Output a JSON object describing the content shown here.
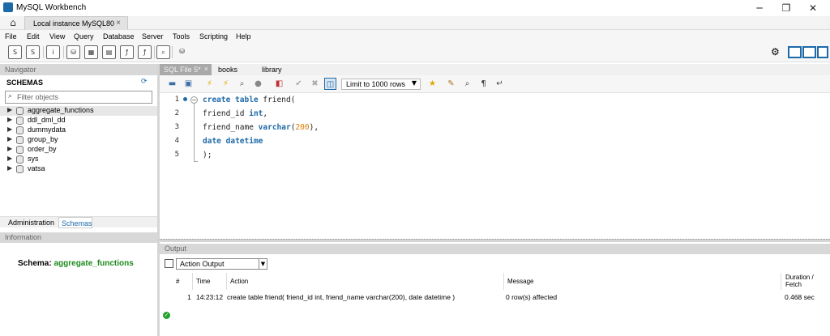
{
  "window": {
    "title": "MySQL Workbench",
    "minimize_glyph": "─",
    "maximize_glyph": "❐",
    "close_glyph": "✕"
  },
  "connection_tab": {
    "label": "Local instance MySQL80",
    "close_glyph": "×"
  },
  "menu": [
    "File",
    "Edit",
    "View",
    "Query",
    "Database",
    "Server",
    "Tools",
    "Scripting",
    "Help"
  ],
  "navigator": {
    "header": "Navigator",
    "schemas_title": "SCHEMAS",
    "filter_placeholder": "Filter objects",
    "schemas": [
      {
        "name": "aggregate_functions",
        "selected": true
      },
      {
        "name": "ddl_dml_dd"
      },
      {
        "name": "dummydata"
      },
      {
        "name": "group_by"
      },
      {
        "name": "order_by"
      },
      {
        "name": "sys"
      },
      {
        "name": "vatsa"
      }
    ],
    "tabs": [
      "Administration",
      "Schemas"
    ],
    "active_tab": "Schemas"
  },
  "information": {
    "header": "Information",
    "schema_label": "Schema:",
    "schema_value": "aggregate_functions"
  },
  "editor_tabs": [
    {
      "label": "SQL File 5*",
      "active": true
    },
    {
      "label": "books"
    },
    {
      "label": "library"
    }
  ],
  "editor_toolbar": {
    "limit_label": "Limit to 1000 rows"
  },
  "editor": {
    "lines": [
      {
        "n": "1"
      },
      {
        "n": "2"
      },
      {
        "n": "3"
      },
      {
        "n": "4"
      },
      {
        "n": "5"
      }
    ],
    "code": {
      "l1_kw": "create table",
      "l1_rest": " friend(",
      "l2_id": "friend_id",
      "l2_type": "int",
      "l2_tail": ",",
      "l3_id": "friend_name",
      "l3_type": "varchar",
      "l3_open": "(",
      "l3_num": "200",
      "l3_close": "),",
      "l4_kw1": "date",
      "l4_kw2": "datetime",
      "l5": ");"
    }
  },
  "output": {
    "header": "Output",
    "select_value": "Action Output",
    "columns": [
      "#",
      "Time",
      "Action",
      "Message",
      "Duration / Fetch"
    ],
    "rows": [
      {
        "num": "1",
        "time": "14:23:12",
        "action": "create table friend( friend_id int, friend_name varchar(200), date datetime )",
        "message": "0 row(s) affected",
        "duration": "0.468 sec",
        "status": "success"
      }
    ]
  },
  "colors": {
    "accent": "#1e6aa8",
    "keyword": "#1e6aa8",
    "number": "#d97c00",
    "schema_value": "#1d8a1d",
    "success": "#22a22a"
  }
}
